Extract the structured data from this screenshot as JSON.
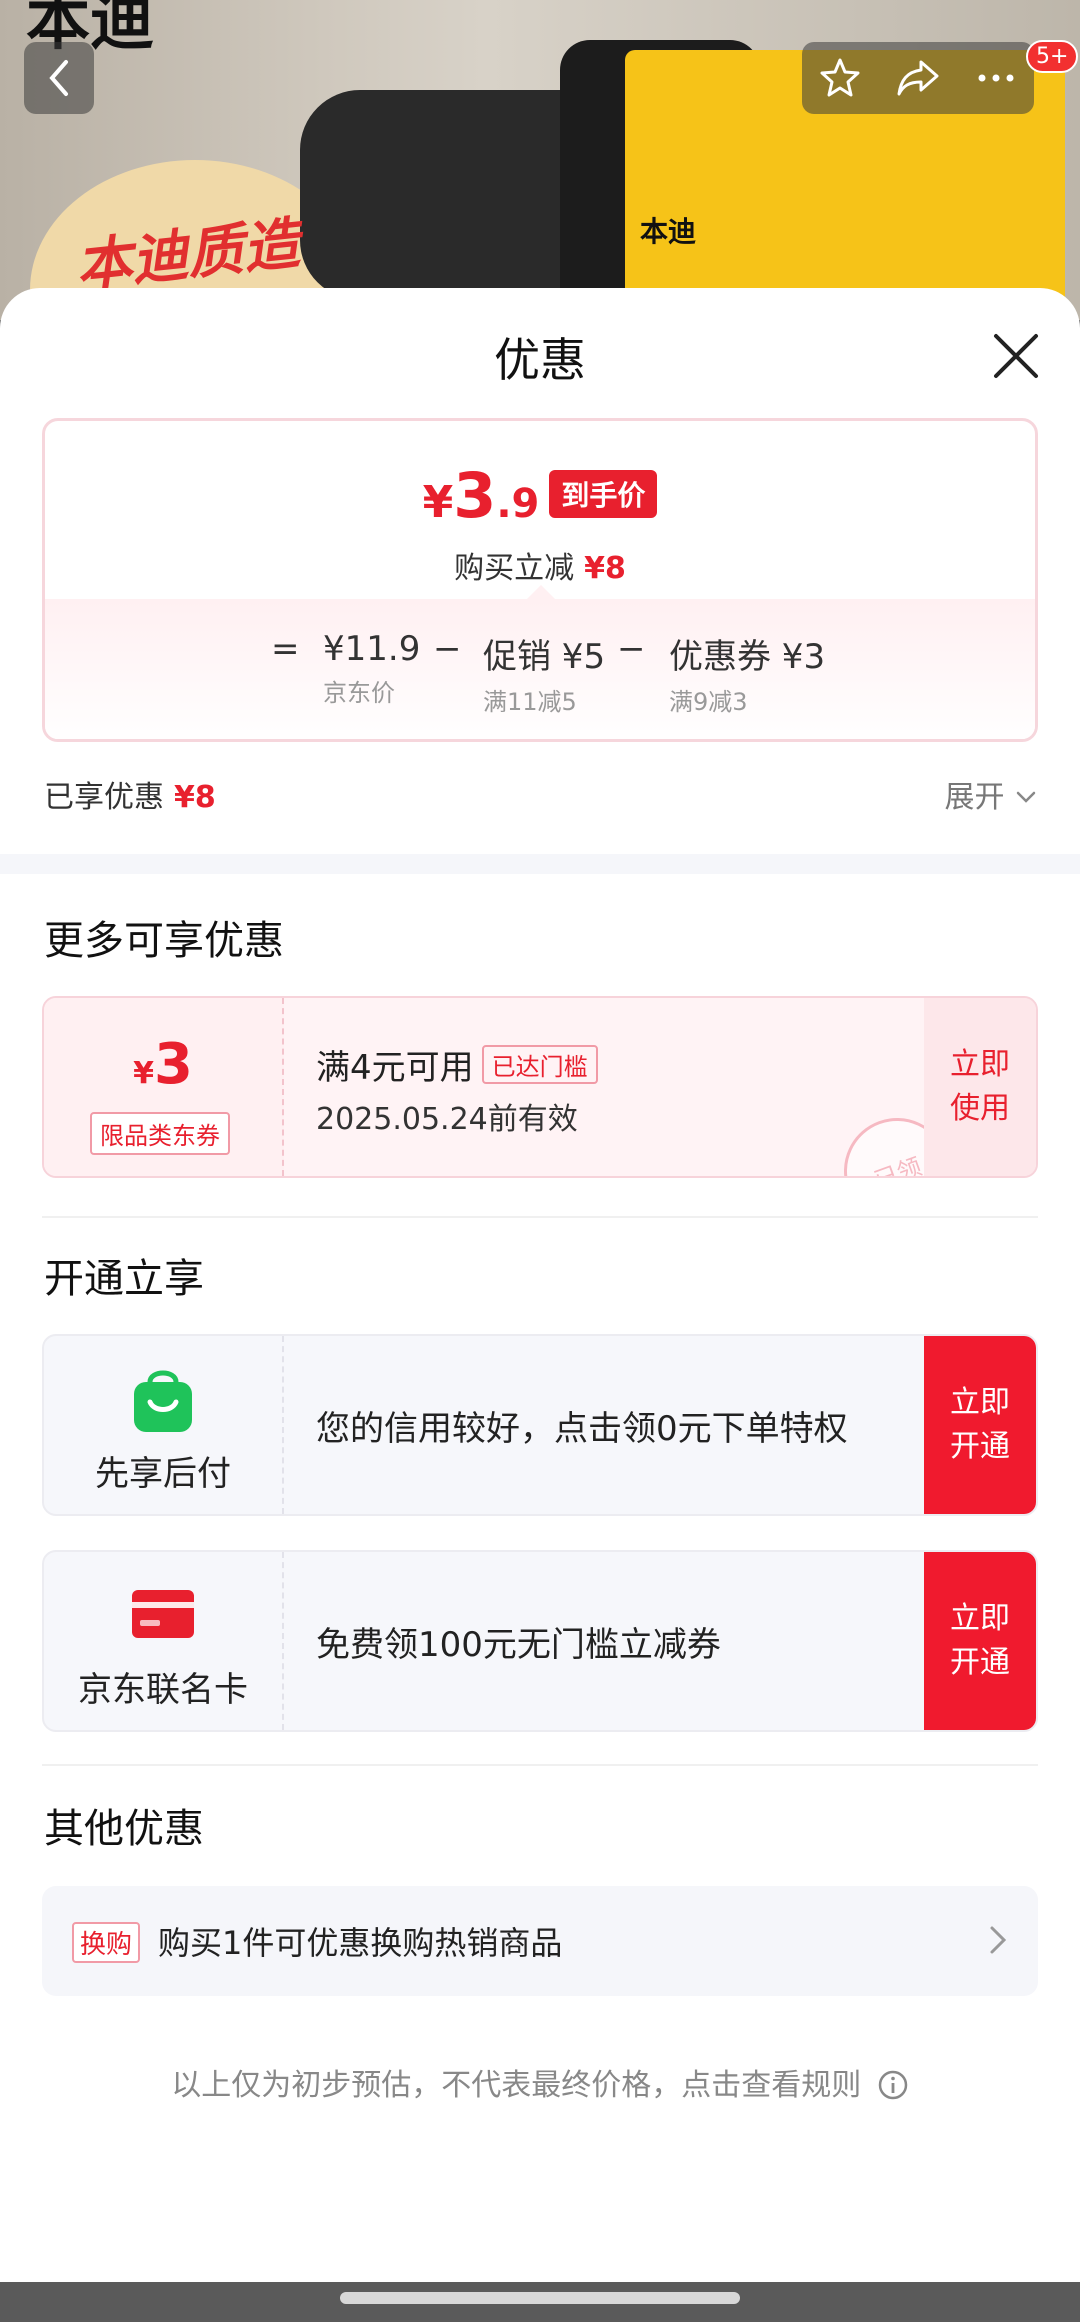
{
  "hero": {
    "brand_top": "本迪",
    "slogan": "本迪质造",
    "bag_label": "本迪",
    "cart_badge": "5+"
  },
  "sheet": {
    "title": "优惠"
  },
  "price_card": {
    "currency": "¥",
    "final_int": "3",
    "final_dec": ".9",
    "final_tag": "到手价",
    "reduce_label": "购买立减",
    "reduce_value": "¥8",
    "eq": "=",
    "minus": "−",
    "items": [
      {
        "value": "¥11.9",
        "sub": "京东价"
      },
      {
        "value": "促销 ¥5",
        "sub": "满11减5"
      },
      {
        "value": "优惠券 ¥3",
        "sub": "满9减3"
      }
    ]
  },
  "enjoyed": {
    "label": "已享优惠",
    "value": "¥8",
    "expand": "展开"
  },
  "more": {
    "title": "更多可享优惠",
    "coupon": {
      "currency": "¥",
      "amount": "3",
      "type": "限品类东券",
      "condition": "满4元可用",
      "reached": "已达门槛",
      "date": "2025.05.24前有效",
      "use_label": "立即使用",
      "stamp": "已领"
    }
  },
  "open": {
    "title": "开通立享",
    "cards": [
      {
        "name": "先享后付",
        "desc": "您的信用较好，点击领0元下单特权",
        "btn": "立即开通",
        "icon": "shopping-bag-icon",
        "color": "#1fc35a"
      },
      {
        "name": "京东联名卡",
        "desc": "免费领100元无门槛立减券",
        "btn": "立即开通",
        "icon": "credit-card-icon",
        "color": "#e8202e"
      }
    ]
  },
  "other": {
    "title": "其他优惠",
    "tag": "换购",
    "text": "购买1件可优惠换购热销商品"
  },
  "footnote": "以上仅为初步预估，不代表最终价格，点击查看规则",
  "colors": {
    "accent": "#e8202e",
    "button_red": "#f01a2e"
  }
}
